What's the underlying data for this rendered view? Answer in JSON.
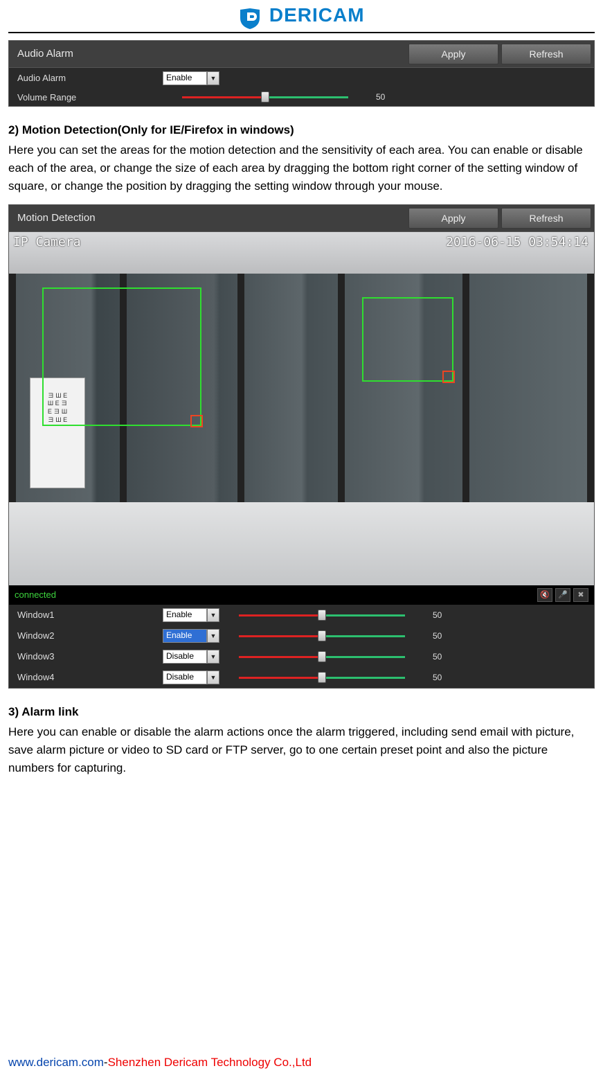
{
  "brand": {
    "name": "DERICAM"
  },
  "audio_panel": {
    "title": "Audio Alarm",
    "apply": "Apply",
    "refresh": "Refresh",
    "rows": {
      "alarm_label": "Audio Alarm",
      "alarm_value": "Enable",
      "volume_label": "Volume Range",
      "volume_value": "50"
    }
  },
  "section2": {
    "heading": "2) Motion Detection(Only for IE/Firefox in windows)",
    "text": "Here you can set the areas for the motion detection and the sensitivity of each area. You can enable or disable each of the area, or change the size of each area by dragging the bottom right corner of the setting window of square, or change the position by dragging the setting window through your mouse."
  },
  "motion_panel": {
    "title": "Motion Detection",
    "apply": "Apply",
    "refresh": "Refresh",
    "overlay_label": "IP Camera",
    "overlay_timestamp": "2016-06-15 03:54:14",
    "status": "connected",
    "windows": [
      {
        "label": "Window1",
        "value": "Enable",
        "slider": "50",
        "hl": false
      },
      {
        "label": "Window2",
        "value": "Enable",
        "slider": "50",
        "hl": true
      },
      {
        "label": "Window3",
        "value": "Disable",
        "slider": "50",
        "hl": false
      },
      {
        "label": "Window4",
        "value": "Disable",
        "slider": "50",
        "hl": false
      }
    ]
  },
  "section3": {
    "heading": "3) Alarm link",
    "text": "Here you can enable or disable the alarm actions once the alarm triggered, including send email with picture, save alarm picture or video to SD card or FTP server, go to one certain preset point and also the picture numbers for capturing."
  },
  "footer": {
    "link": "www.dericam.com",
    "dash": "-",
    "company": "Shenzhen Dericam Technology Co.,Ltd"
  }
}
